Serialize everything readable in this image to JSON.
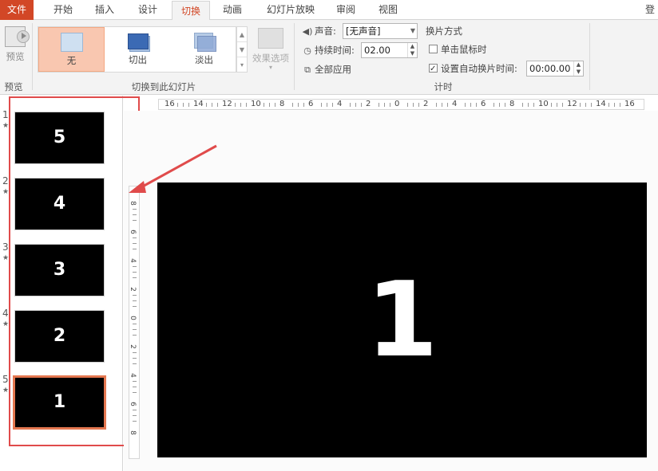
{
  "tabs": [
    {
      "label": "文件",
      "kind": "file"
    },
    {
      "label": "开始",
      "kind": "normal"
    },
    {
      "label": "插入",
      "kind": "normal"
    },
    {
      "label": "设计",
      "kind": "normal"
    },
    {
      "label": "切换",
      "kind": "active"
    },
    {
      "label": "动画",
      "kind": "normal"
    },
    {
      "label": "幻灯片放映",
      "kind": "normal"
    },
    {
      "label": "审阅",
      "kind": "normal"
    },
    {
      "label": "视图",
      "kind": "normal"
    }
  ],
  "login_label": "登",
  "ribbon": {
    "preview": {
      "button_label": "预览",
      "group_label": "预览"
    },
    "transitions": {
      "group_label": "切换到此幻灯片",
      "items": [
        {
          "label": "无",
          "selected": true
        },
        {
          "label": "切出",
          "selected": false
        },
        {
          "label": "淡出",
          "selected": false
        }
      ],
      "effect_options_label": "效果选项"
    },
    "timing": {
      "group_label": "计时",
      "sound_label": "声音:",
      "sound_value": "[无声音]",
      "duration_label": "持续时间:",
      "duration_value": "02.00",
      "apply_all_label": "全部应用",
      "advance_label": "换片方式",
      "on_click_label": "单击鼠标时",
      "on_click_checked": false,
      "after_label": "设置自动换片时间:",
      "after_checked": true,
      "after_value": "00:00.00"
    }
  },
  "hruler_labels": [
    "16",
    "14",
    "12",
    "10",
    "8",
    "6",
    "4",
    "2",
    "0",
    "2",
    "4",
    "6",
    "8",
    "10",
    "12",
    "14",
    "16"
  ],
  "vruler_labels": [
    "8",
    "6",
    "4",
    "2",
    "0",
    "2",
    "4",
    "6",
    "8"
  ],
  "slides": [
    {
      "number": "1",
      "content": "5",
      "selected": false
    },
    {
      "number": "2",
      "content": "4",
      "selected": false
    },
    {
      "number": "3",
      "content": "3",
      "selected": false
    },
    {
      "number": "4",
      "content": "2",
      "selected": false
    },
    {
      "number": "5",
      "content": "1",
      "selected": true
    }
  ],
  "slide_star": "★",
  "main_slide": {
    "content": "1"
  },
  "colors": {
    "accent": "#d24726",
    "annotation": "#e04b4b",
    "selected_thumb_border": "#e47750",
    "gallery_selected": "#f9c7b0",
    "slide_bg": "#000000"
  }
}
